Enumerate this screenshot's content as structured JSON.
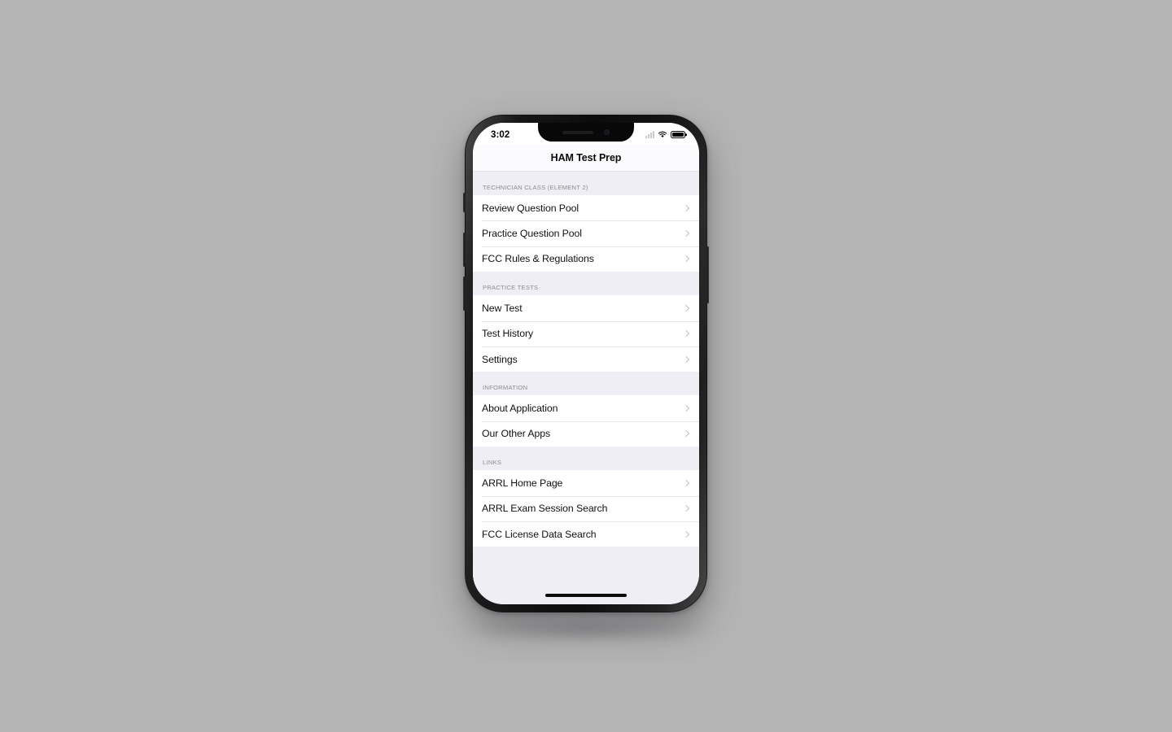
{
  "scene": {
    "background_color": "#b4b4b4"
  },
  "device": {
    "frame_color": "#101010",
    "notch": {
      "speaker_icon": "speaker-grille-icon",
      "camera_icon": "front-camera-icon"
    },
    "buttons": {
      "mute_switch": "mute-switch",
      "volume_up": "volume-up-button",
      "volume_down": "volume-down-button",
      "power": "power-button"
    },
    "home_indicator": "home-indicator"
  },
  "status_bar": {
    "time": "3:02",
    "icons": {
      "signal": "cellular-signal-icon",
      "wifi": "wifi-icon",
      "battery": "battery-icon"
    }
  },
  "nav_bar": {
    "title": "HAM Test Prep"
  },
  "colors": {
    "screen_background": "#eeeef4",
    "row_background": "#ffffff",
    "separator": "#e6e6ea",
    "section_header_text": "#8b8b90",
    "row_text": "#111114",
    "chevron": "#c2c2c7"
  },
  "sections": [
    {
      "header": "TECHNICIAN CLASS (ELEMENT 2)",
      "rows": [
        {
          "label": "Review Question Pool",
          "accessory": "chevron-right-icon"
        },
        {
          "label": "Practice Question Pool",
          "accessory": "chevron-right-icon"
        },
        {
          "label": "FCC Rules & Regulations",
          "accessory": "chevron-right-icon"
        }
      ]
    },
    {
      "header": "PRACTICE TESTS",
      "rows": [
        {
          "label": "New Test",
          "accessory": "chevron-right-icon"
        },
        {
          "label": "Test History",
          "accessory": "chevron-right-icon"
        },
        {
          "label": "Settings",
          "accessory": "chevron-right-icon"
        }
      ]
    },
    {
      "header": "INFORMATION",
      "rows": [
        {
          "label": "About Application",
          "accessory": "chevron-right-icon"
        },
        {
          "label": "Our Other Apps",
          "accessory": "chevron-right-icon"
        }
      ]
    },
    {
      "header": "LINKS",
      "rows": [
        {
          "label": "ARRL Home Page",
          "accessory": "chevron-right-icon"
        },
        {
          "label": "ARRL Exam Session Search",
          "accessory": "chevron-right-icon"
        },
        {
          "label": "FCC License Data Search",
          "accessory": "chevron-right-icon"
        }
      ]
    }
  ]
}
